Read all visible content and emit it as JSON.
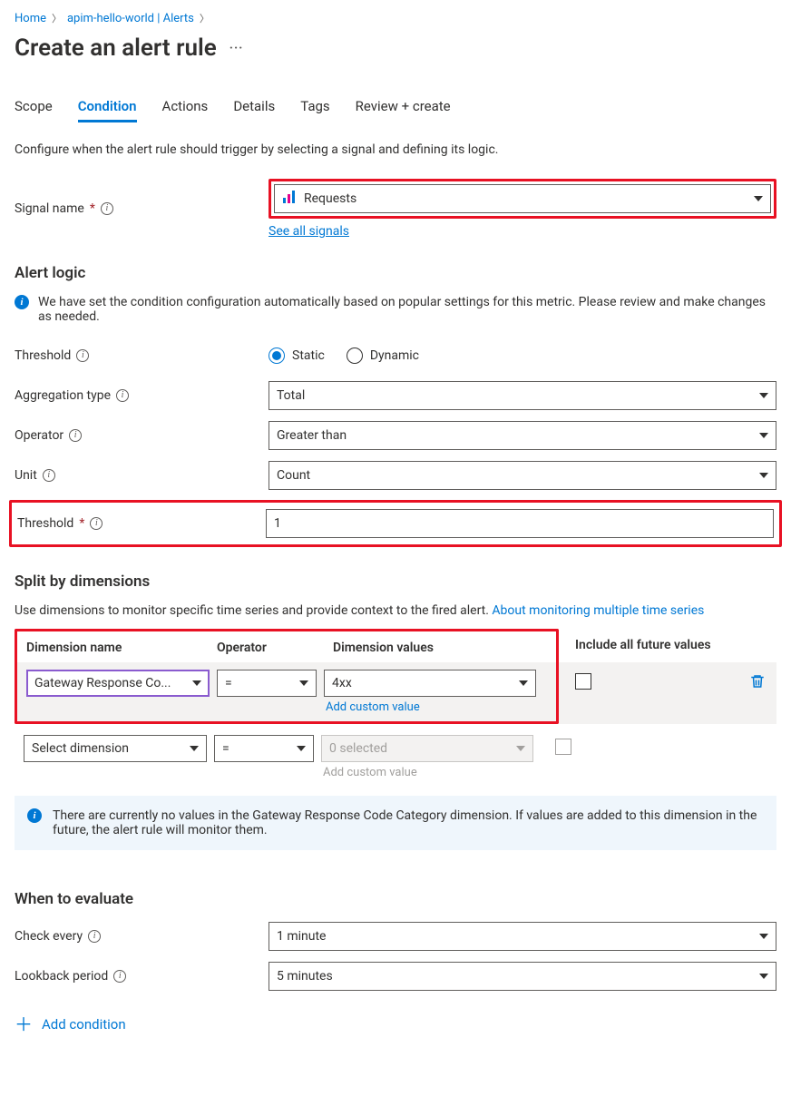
{
  "breadcrumb": {
    "home": "Home",
    "resource": "apim-hello-world | Alerts"
  },
  "page": {
    "title": "Create an alert rule"
  },
  "tabs": {
    "scope": "Scope",
    "condition": "Condition",
    "actions": "Actions",
    "details": "Details",
    "tags": "Tags",
    "review": "Review + create"
  },
  "intro": "Configure when the alert rule should trigger by selecting a signal and defining its logic.",
  "signal": {
    "label": "Signal name",
    "value": "Requests",
    "see_all": "See all signals"
  },
  "alert_logic": {
    "heading": "Alert logic",
    "note": "We have set the condition configuration automatically based on popular settings for this metric. Please review and make changes as needed.",
    "threshold_label": "Threshold",
    "threshold_radio_static": "Static",
    "threshold_radio_dynamic": "Dynamic",
    "aggregation_label": "Aggregation type",
    "aggregation_value": "Total",
    "operator_label": "Operator",
    "operator_value": "Greater than",
    "unit_label": "Unit",
    "unit_value": "Count",
    "threshold_value_label": "Threshold",
    "threshold_value": "1"
  },
  "dimensions": {
    "heading": "Split by dimensions",
    "desc_plain": "Use dimensions to monitor specific time series and provide context to the fired alert. ",
    "desc_link": "About monitoring multiple time series",
    "col_name": "Dimension name",
    "col_op": "Operator",
    "col_val": "Dimension values",
    "col_incl": "Include all future values",
    "row1": {
      "name": "Gateway Response Co...",
      "op": "=",
      "val": "4xx",
      "add_custom": "Add custom value"
    },
    "row2": {
      "name": "Select dimension",
      "op": "=",
      "val_placeholder": "0 selected",
      "add_custom": "Add custom value"
    },
    "info": "There are currently no values in the Gateway Response Code Category dimension. If values are added to this dimension in the future, the alert rule will monitor them."
  },
  "evaluate": {
    "heading": "When to evaluate",
    "check_label": "Check every",
    "check_value": "1 minute",
    "lookback_label": "Lookback period",
    "lookback_value": "5 minutes"
  },
  "add_condition": "Add condition"
}
